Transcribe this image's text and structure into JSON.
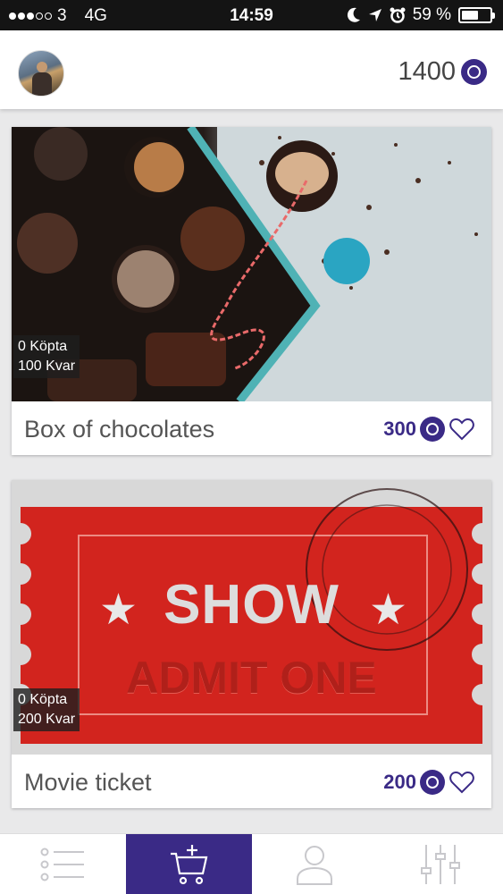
{
  "status_bar": {
    "carrier": "3",
    "network": "4G",
    "time": "14:59",
    "battery": "59 %",
    "battery_level": 0.59,
    "signal_bars": 3
  },
  "header": {
    "points": "1400",
    "currency_icon": "coin-icon"
  },
  "products": [
    {
      "title": "Box of chocolates",
      "bought": "0 Köpta",
      "remaining": "100 Kvar",
      "price": "300",
      "favorite": false
    },
    {
      "title": "Movie ticket",
      "bought": "0 Köpta",
      "remaining": "200 Kvar",
      "price": "200",
      "favorite": false,
      "image_text": {
        "show": "SHOW",
        "admit": "ADMIT ONE"
      }
    }
  ],
  "bottom_nav": {
    "active_index": 1,
    "items": [
      {
        "icon": "list-icon"
      },
      {
        "icon": "cart-add-icon"
      },
      {
        "icon": "user-icon"
      },
      {
        "icon": "sliders-icon"
      }
    ]
  },
  "colors": {
    "accent": "#3a2a86",
    "status_bar": "#141414",
    "background": "#e9e9ea"
  }
}
